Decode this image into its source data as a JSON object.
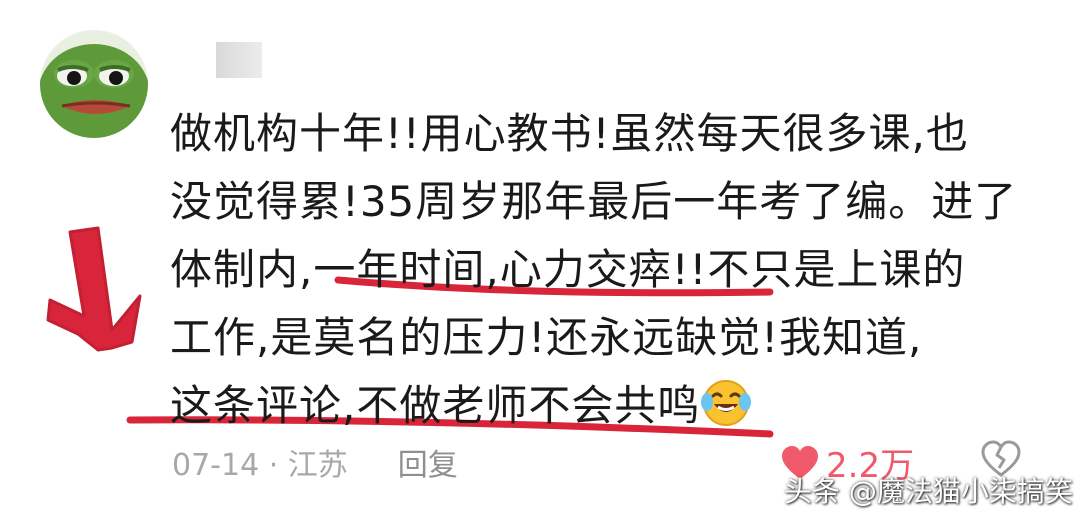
{
  "comment": {
    "lines": [
      "做机构十年!!用心教书!虽然每天很多课,也",
      "没觉得累!35周岁那年最后一年考了编。进了",
      "体制内,一年时间,心力交瘁!!不只是上课的",
      "工作,是莫名的压力!还永远缺觉!我知道,",
      "这条评论,不做老师不会共鸣"
    ],
    "emoji": "laughing-crying-emoji"
  },
  "meta": {
    "date_location": "07-14 · 江苏",
    "reply_label": "回复"
  },
  "likes": {
    "count": "2.2万"
  },
  "watermark": {
    "text": "头条 @魔法猫小柒搞笑"
  },
  "colors": {
    "annotation_red": "#d8253a",
    "like_red": "#f05a6a",
    "meta_gray": "#a8a8a8"
  }
}
